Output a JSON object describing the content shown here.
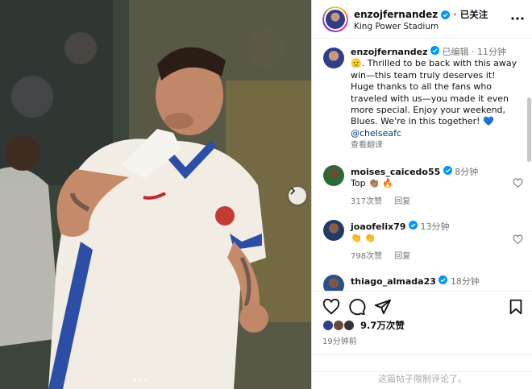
{
  "header": {
    "username": "enzojfernandez",
    "follow_label": "已关注",
    "location": "King Power Stadium"
  },
  "caption": {
    "username": "enzojfernandez",
    "edited": "已编辑",
    "separator": "·",
    "time": "11分钟",
    "emoji": "🫡",
    "text": ". Thrilled to be back with this away win—this team truly deserves it! Huge thanks to all the fans who traveled with us—you made it even more special. Enjoy your weekend, Blues. We're in this together! ",
    "heart": "💙",
    "mention": "@chelseafc",
    "translate": "查看翻译"
  },
  "comments": [
    {
      "username": "moises_caicedo55",
      "time": "8分钟",
      "text": "Top 👏🏽 🔥",
      "likes": "317次赞",
      "reply": "回复"
    },
    {
      "username": "joaofelix79",
      "time": "13分钟",
      "text": "👏 👏",
      "likes": "798次赞",
      "reply": "回复"
    },
    {
      "username": "thiago_almada23",
      "time": "18分钟"
    }
  ],
  "footer": {
    "likes": "9.7万次赞",
    "time_ago": "19分钟前",
    "limited_notice": "这篇帖子限制评论了。"
  },
  "icons": {
    "verified": "verified-badge-icon",
    "more": "more-options-icon",
    "like": "heart-icon",
    "comment": "comment-icon",
    "share": "share-icon",
    "save": "bookmark-icon",
    "next": "chevron-right-icon"
  },
  "colors": {
    "verified_blue": "#0095f6",
    "link": "#00376b",
    "secondary_text": "#737373"
  }
}
